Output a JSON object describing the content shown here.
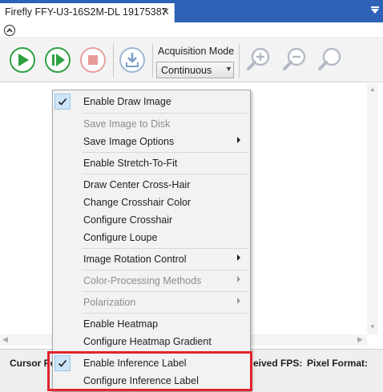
{
  "window": {
    "tab_title": "Firefly FFY-U3-16S2M-DL 19175387",
    "close_glyph": "✕"
  },
  "toolbar": {
    "acquisition_mode_label": "Acquisition Mode",
    "acquisition_mode_value": "Continuous",
    "buttons": [
      "play-icon",
      "step-icon",
      "stop-icon",
      "save-image-icon",
      "zoom-in-icon",
      "zoom-out-icon",
      "zoom-fit-icon"
    ]
  },
  "context_menu": {
    "items": [
      {
        "label": "Enable Draw Image",
        "checked": true,
        "enabled": true
      },
      {
        "label": "Save Image to Disk",
        "enabled": false
      },
      {
        "label": "Save Image Options",
        "enabled": true,
        "submenu": true
      },
      {
        "label": "Enable Stretch-To-Fit",
        "enabled": true
      },
      {
        "label": "Draw Center Cross-Hair",
        "enabled": true
      },
      {
        "label": "Change Crosshair Color",
        "enabled": true
      },
      {
        "label": "Configure Crosshair",
        "enabled": true
      },
      {
        "label": "Configure Loupe",
        "enabled": true
      },
      {
        "label": "Image Rotation Control",
        "enabled": true,
        "submenu": true
      },
      {
        "label": "Color-Processing Methods",
        "enabled": false,
        "submenu": true
      },
      {
        "label": "Polarization",
        "enabled": false,
        "submenu": true
      },
      {
        "label": "Enable Heatmap",
        "enabled": true
      },
      {
        "label": "Configure Heatmap Gradient",
        "enabled": true
      },
      {
        "label": "Enable Inference Label",
        "checked": true,
        "enabled": true
      },
      {
        "label": "Configure Inference Label",
        "enabled": true
      }
    ]
  },
  "status_bar": {
    "cursor_label": "Cursor Po",
    "received_fps_label": "eived FPS:",
    "pixel_format_label": "Pixel Format:"
  },
  "colors": {
    "tab_strip": "#2d62b6",
    "play_green": "#2ea043",
    "stop_red": "#d9534f",
    "highlight_red": "#e0242c",
    "check_bg": "#cce4f7"
  }
}
